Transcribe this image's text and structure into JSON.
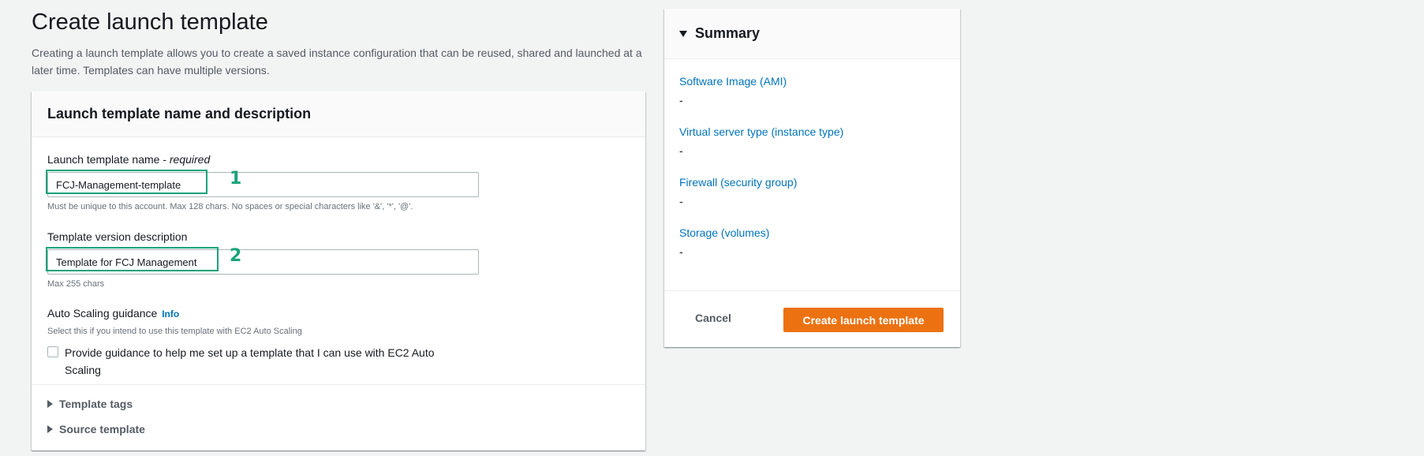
{
  "page": {
    "title": "Create launch template",
    "description": "Creating a launch template allows you to create a saved instance configuration that can be reused, shared and launched at a later time. Templates can have multiple versions."
  },
  "panel": {
    "title": "Launch template name and description",
    "name_field": {
      "label": "Launch template name - ",
      "required": "required",
      "value": "FCJ-Management-template",
      "hint": "Must be unique to this account. Max 128 chars. No spaces or special characters like '&', '*', '@'."
    },
    "description_field": {
      "label": "Template version description",
      "value": "Template for FCJ Management",
      "hint": "Max 255 chars"
    },
    "auto_scaling": {
      "label": "Auto Scaling guidance",
      "info": "Info",
      "hint": "Select this if you intend to use this template with EC2 Auto Scaling",
      "checkbox_label": "Provide guidance to help me set up a template that I can use with EC2 Auto Scaling",
      "checked": false
    },
    "expanders": [
      "Template tags",
      "Source template"
    ]
  },
  "annotations": [
    "1",
    "2"
  ],
  "summary": {
    "title": "Summary",
    "items": [
      {
        "label": "Software Image (AMI)",
        "value": "-"
      },
      {
        "label": "Virtual server type (instance type)",
        "value": "-"
      },
      {
        "label": "Firewall (security group)",
        "value": "-"
      },
      {
        "label": "Storage (volumes)",
        "value": "-"
      }
    ],
    "cancel": "Cancel",
    "create": "Create launch template"
  },
  "colors": {
    "accent_orange": "#ec7211",
    "link_blue": "#0073bb",
    "annotation_green": "#1aa37a"
  }
}
